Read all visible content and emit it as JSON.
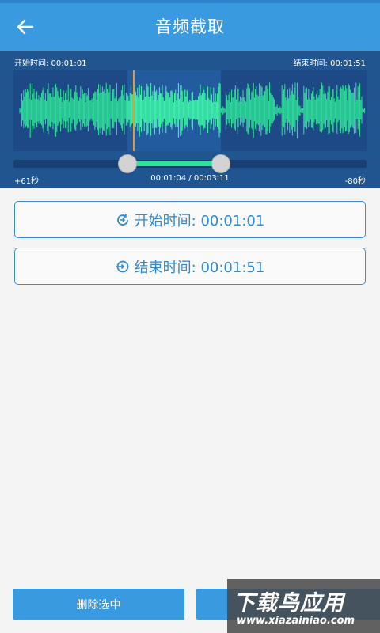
{
  "app_bar": {
    "title": "音频截取",
    "back_icon": "arrow-left-icon"
  },
  "waveform": {
    "start_label": "开始时间: 00:01:01",
    "end_label": "结束时间: 00:01:51",
    "selection_start_fraction": 0.3216,
    "selection_end_fraction": 0.5848,
    "wave_color": "#2fe39a",
    "wave_color_selected": "#3ffca8"
  },
  "slider": {
    "left_offset": "+61秒",
    "position": "00:01:04 / 00:03:11",
    "right_offset": "-80秒"
  },
  "buttons": {
    "start_time": "开始时间: 00:01:01",
    "end_time": "结束时间: 00:01:51",
    "delete_selected": "删除选中",
    "start_icon": "start-time-icon",
    "end_icon": "end-time-icon"
  },
  "watermark": {
    "title": "下载鸟应用",
    "url": "www.xiazainiao.com"
  }
}
